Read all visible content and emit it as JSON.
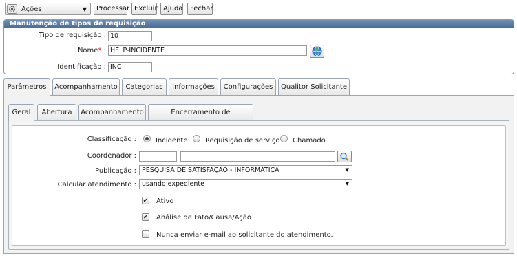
{
  "toolbar": {
    "actions_label": "Ações",
    "buttons": [
      "Processar",
      "Excluir",
      "Ajuda",
      "Fechar"
    ]
  },
  "panel": {
    "title": "Manutenção de tipos de requisição",
    "fields": {
      "tipo_label": "Tipo de requisição :",
      "tipo_value": "10",
      "nome_label": "Nome",
      "nome_required": "*",
      "nome_colon": ":",
      "nome_value": "HELP-INCIDENTE",
      "ident_label": "Identificação :",
      "ident_value": "INC"
    }
  },
  "tabs": [
    "Parâmetros",
    "Acompanhamento",
    "Categorias",
    "Informações",
    "Configurações",
    "Qualitor Solicitante"
  ],
  "subtabs": [
    "Geral",
    "Abertura",
    "Acompanhamento",
    "Encerramento de atendimento"
  ],
  "form": {
    "classificacao_label": "Classificação :",
    "classificacao_options": [
      "Incidente",
      "Requisição de serviço",
      "Chamado"
    ],
    "classificacao_selected": "Incidente",
    "coordenador_label": "Coordenador :",
    "coordenador_code": "",
    "coordenador_name": "",
    "publicacao_label": "Publicação :",
    "publicacao_value": "PESQUISA DE SATISFAÇÃO - INFORMÁTICA",
    "calcular_label": "Calcular atendimento :",
    "calcular_value": "usando expediente",
    "checkboxes": [
      {
        "label": "Ativo",
        "checked": true
      },
      {
        "label": "Análise de Fato/Causa/Ação",
        "checked": true
      },
      {
        "label": "Nunca enviar e-mail ao solicitante do atendimento.",
        "checked": false
      }
    ]
  },
  "icons": {
    "actions": "gear-icon",
    "globe": "globe-icon",
    "search": "magnifier-icon"
  },
  "colors": {
    "panel_title_bg": "#5a7ca6",
    "required": "#e02020"
  }
}
